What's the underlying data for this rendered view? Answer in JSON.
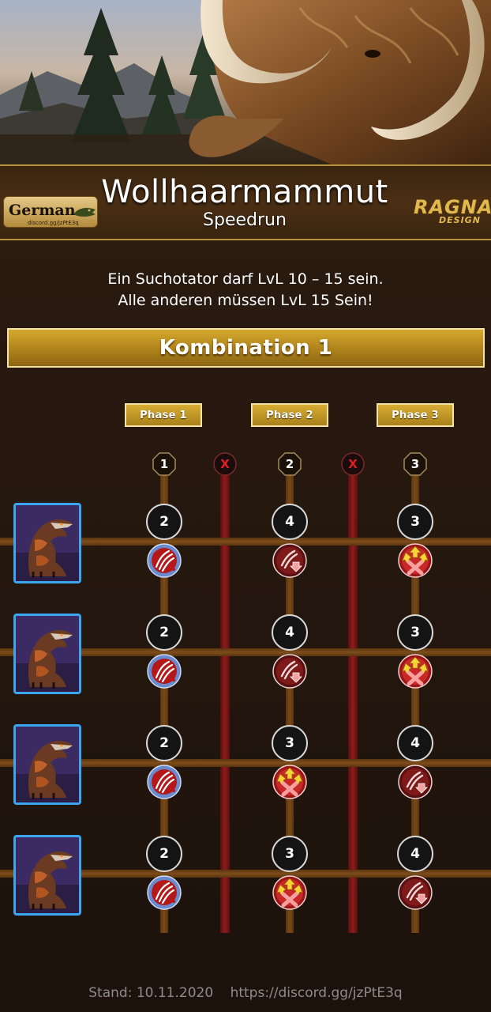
{
  "header": {
    "title": "Wollhaarmammut",
    "subtitle": "Speedrun",
    "logo_left_name": "German",
    "logo_left_link": "discord.gg/jzPtE3q",
    "logo_right_line1": "RAGNA",
    "logo_right_line2": "DESIGN"
  },
  "rules": {
    "line1": "Ein Suchotator darf LvL 10 – 15 sein.",
    "line2": "Alle anderen müssen LvL 15 Sein!"
  },
  "combination": {
    "label": "Kombination 1"
  },
  "phases": [
    "Phase 1",
    "Phase 2",
    "Phase 3"
  ],
  "turn_markers": [
    "1",
    "X",
    "2",
    "X",
    "3"
  ],
  "rows": [
    {
      "dino": "Suchotator",
      "moves": [
        {
          "count": "2",
          "icon": "bleed-claw-icon"
        },
        {
          "count": "4",
          "icon": "distract-claw-icon"
        },
        {
          "count": "3",
          "icon": "cleanse-up-icon"
        }
      ]
    },
    {
      "dino": "Suchotator",
      "moves": [
        {
          "count": "2",
          "icon": "bleed-claw-icon"
        },
        {
          "count": "4",
          "icon": "distract-claw-icon"
        },
        {
          "count": "3",
          "icon": "cleanse-up-icon"
        }
      ]
    },
    {
      "dino": "Suchotator",
      "moves": [
        {
          "count": "2",
          "icon": "bleed-claw-icon"
        },
        {
          "count": "3",
          "icon": "cleanse-up-icon"
        },
        {
          "count": "4",
          "icon": "distract-claw-icon"
        }
      ]
    },
    {
      "dino": "Suchotator",
      "moves": [
        {
          "count": "2",
          "icon": "bleed-claw-icon"
        },
        {
          "count": "3",
          "icon": "cleanse-up-icon"
        },
        {
          "count": "4",
          "icon": "distract-claw-icon"
        }
      ]
    }
  ],
  "footer": {
    "date": "Stand: 10.11.2020",
    "link": "https://discord.gg/jzPtE3q"
  },
  "colors": {
    "accent_gold": "#c9a03a",
    "card_border": "#3aa6f0",
    "red_track": "#8e1c1c"
  }
}
